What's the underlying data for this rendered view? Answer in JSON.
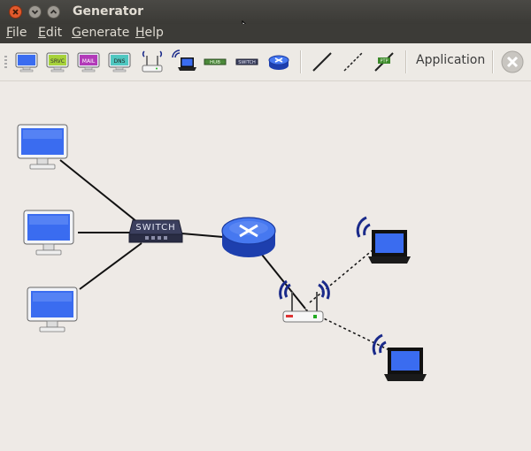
{
  "window": {
    "title": "Generator"
  },
  "menu": {
    "file": {
      "mnemonic": "F",
      "rest": "ile"
    },
    "edit": {
      "mnemonic": "E",
      "rest": "dit"
    },
    "generate": {
      "mnemonic": "G",
      "rest": "enerate"
    },
    "help": {
      "mnemonic": "H",
      "rest": "elp"
    }
  },
  "toolbar": {
    "application_label": "Application",
    "icons": [
      "pc-icon",
      "server-icon",
      "mail-server-icon",
      "dns-server-icon",
      "access-point-icon",
      "wifi-laptop-icon",
      "hub-icon",
      "switch-icon",
      "router-icon",
      "wired-link-icon",
      "wireless-link-icon",
      "ptp-link-icon",
      "delete-icon"
    ],
    "tags": {
      "server": "SRVC",
      "mail": "MAIL",
      "dns": "DNS",
      "hub": "HUB",
      "switch": "SWITCH",
      "ptp": "PTP"
    }
  },
  "canvas": {
    "switch_label": "SWITCH",
    "colors": {
      "screen": "#3a6cf0",
      "router": "#2e57d6",
      "link": "#111111",
      "wifi": "#1a2a8a"
    }
  }
}
